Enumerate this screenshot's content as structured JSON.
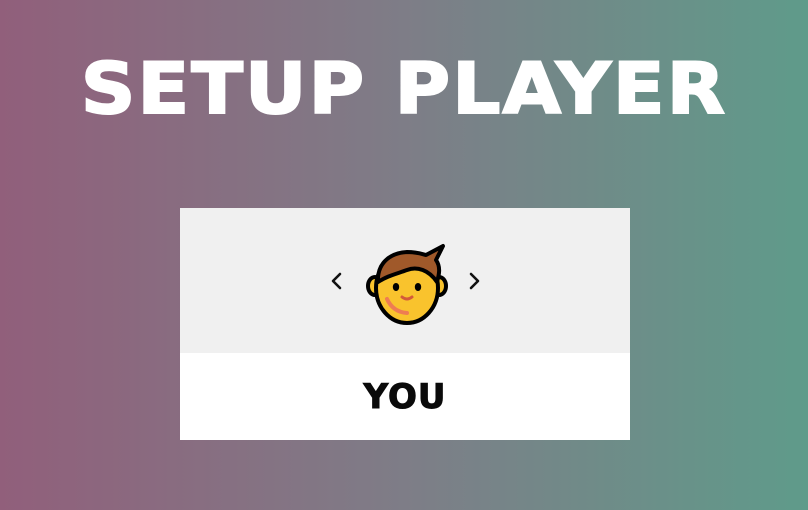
{
  "screen": {
    "title": "SETUP PLAYER"
  },
  "player": {
    "name": "YOU",
    "avatar_icon": "man-face-emoji-icon"
  },
  "controls": {
    "prev_icon": "chevron-left-icon",
    "next_icon": "chevron-right-icon"
  },
  "colors": {
    "background_gradient_start": "#915f7b",
    "background_gradient_end": "#5f9b8a",
    "avatar_panel_bg": "#f0f0f0",
    "name_panel_bg": "#ffffff",
    "title_text": "#ffffff",
    "name_text": "#0a0a0a"
  }
}
